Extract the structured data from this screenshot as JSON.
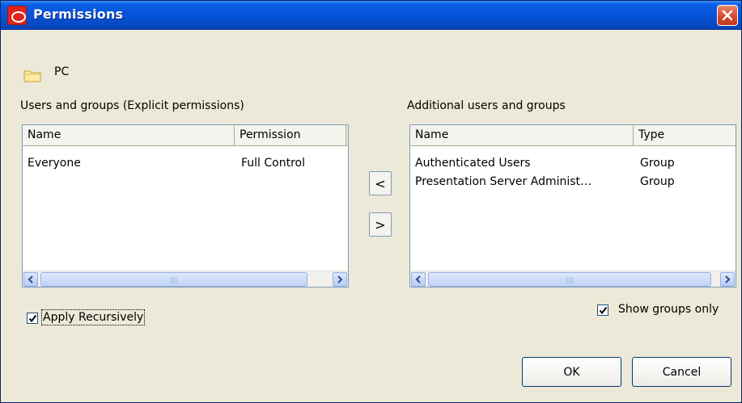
{
  "window": {
    "title": "Permissions",
    "icon": "oracle-icon",
    "close_icon": "close-icon"
  },
  "folder": {
    "icon": "folder-icon",
    "label": "PC"
  },
  "explicit": {
    "label": "Users and groups (Explicit permissions)",
    "columns": [
      "Name",
      "Permission"
    ],
    "rows": [
      {
        "name": "Everyone",
        "permission": "Full Control"
      }
    ]
  },
  "additional": {
    "label": "Additional users and groups",
    "columns": [
      "Name",
      "Type"
    ],
    "rows": [
      {
        "name": "Authenticated Users",
        "type": "Group"
      },
      {
        "name": "Presentation Server Administ…",
        "type": "Group"
      }
    ]
  },
  "move": {
    "add_label": "<",
    "remove_label": ">"
  },
  "options": {
    "apply_recursively": {
      "label": "Apply Recursively",
      "checked": true
    },
    "show_groups_only": {
      "label": "Show groups only",
      "checked": true
    }
  },
  "buttons": {
    "ok": "OK",
    "cancel": "Cancel"
  },
  "colors": {
    "titlebar": "#0553d8",
    "dialog_bg": "#ece9d8",
    "close": "#d5452a",
    "oracle_red": "#e2231a"
  }
}
